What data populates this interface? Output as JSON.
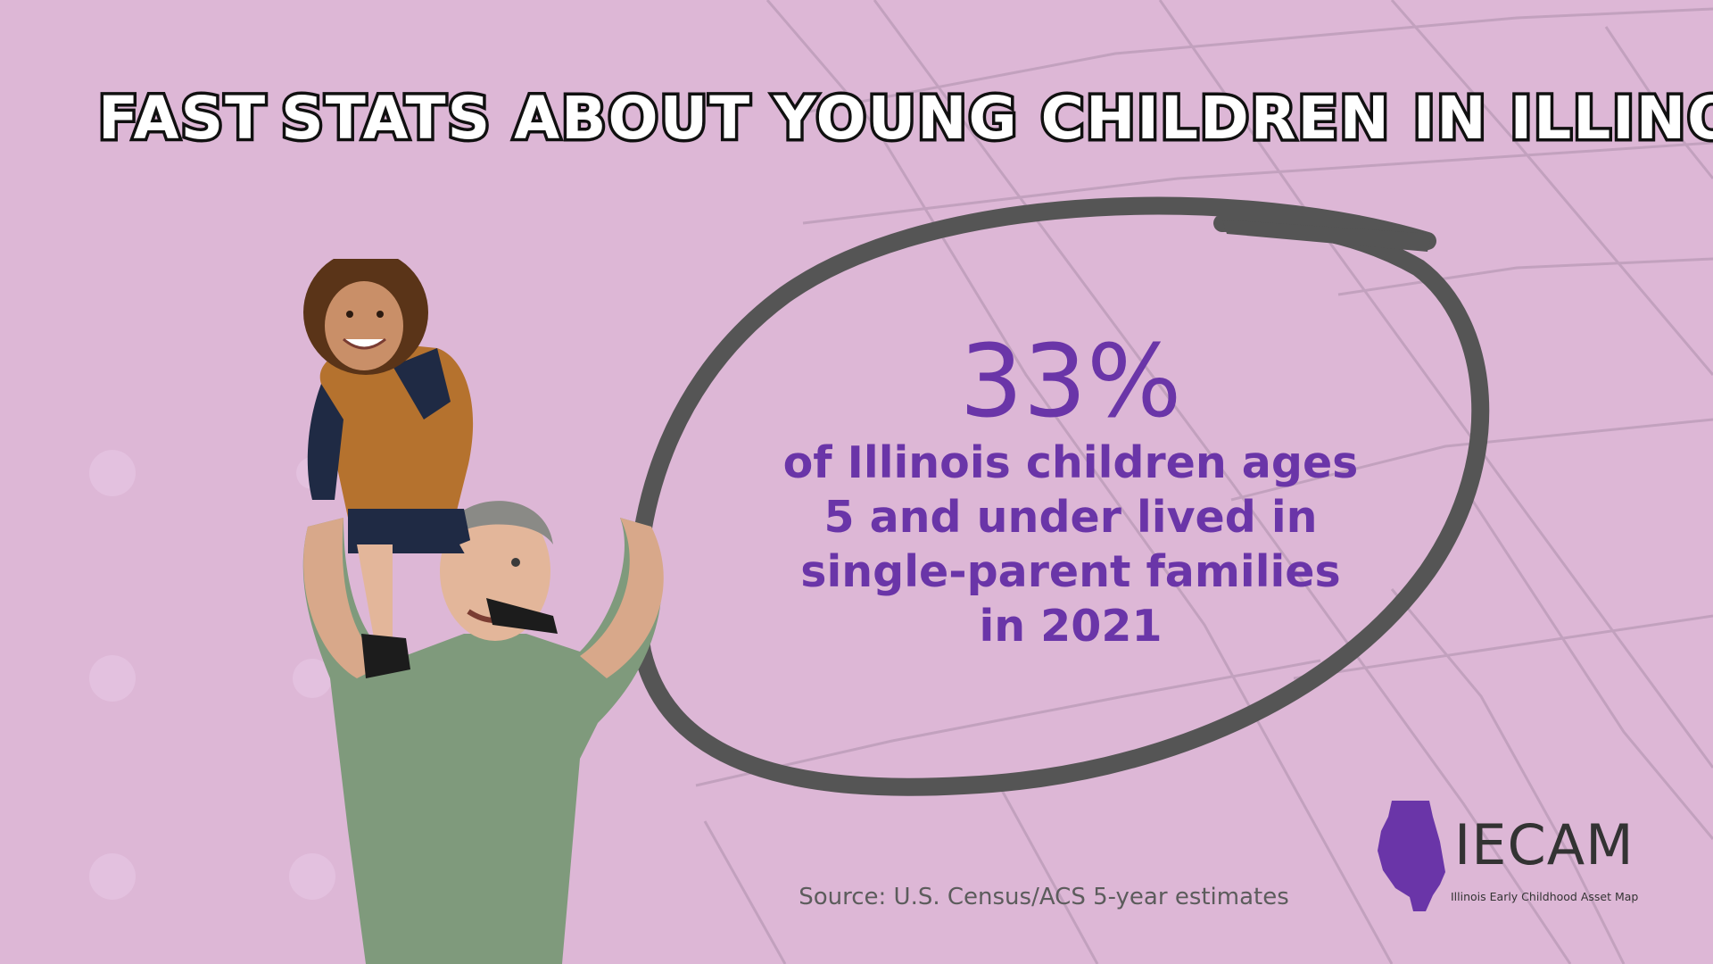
{
  "header": {
    "title_left": "FAST",
    "title_right": "STATS ABOUT YOUNG CHILDREN IN ILLINOIS"
  },
  "stat": {
    "value": "33%",
    "desc_lines": [
      "of Illinois children ages",
      "5 and under lived in",
      "single-parent families",
      "in 2021"
    ]
  },
  "source": "Source: U.S. Census/ACS 5-year estimates",
  "logo": {
    "name": "IECAM",
    "subtitle": "Illinois Early Childhood Asset Map"
  },
  "colors": {
    "background": "#ddb7d6",
    "accent_purple": "#6a35a8",
    "bolt_yellow": "#f3ea4a",
    "circle_gray": "#555555"
  },
  "icons": {
    "bolt": "lightning-bolt-icon",
    "state": "illinois-state-icon"
  }
}
